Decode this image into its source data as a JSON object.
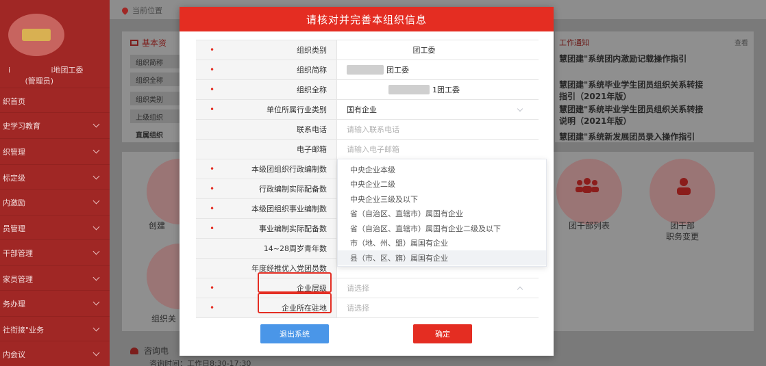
{
  "topbar": {
    "location_label": "当前位置"
  },
  "sidebar": {
    "org_name": "i                 i地团工委\n       (管理员)",
    "items": [
      {
        "label": "织首页",
        "has_chevron": false
      },
      {
        "label": "史学习教育",
        "has_chevron": true
      },
      {
        "label": "织管理",
        "has_chevron": true
      },
      {
        "label": "标定级",
        "has_chevron": true
      },
      {
        "label": "内激励",
        "has_chevron": true
      },
      {
        "label": "员管理",
        "has_chevron": true
      },
      {
        "label": "干部管理",
        "has_chevron": true
      },
      {
        "label": "家员管理",
        "has_chevron": true
      },
      {
        "label": "务办理",
        "has_chevron": true
      },
      {
        "label": "社衔接\"业务",
        "has_chevron": true
      },
      {
        "label": "内会议",
        "has_chevron": true
      }
    ]
  },
  "basic_panel": {
    "title": "基本资",
    "rows": [
      "组织简称",
      "组织全称",
      "组织类别",
      "上级组织",
      "直属组织"
    ]
  },
  "notice_panel": {
    "title": "工作通知",
    "more": "查看",
    "items": [
      "慧团建\"系统团内激励记载操作指引",
      "慧团建\"系统毕业学生团员组织关系转接\n指引（2021年版）",
      "慧团建\"系统毕业学生团员组织关系转接\n说明（2021年版）",
      "慧团建\"系统新发展团员录入操作指引"
    ]
  },
  "func_panel": {
    "items": [
      {
        "label": "创建"
      },
      {
        "label": "组织关"
      },
      {
        "label": "团干部列表"
      },
      {
        "label": "团干部\n职务变更"
      }
    ]
  },
  "consult": {
    "label": "咨询电",
    "time": "咨询时间：工作日8:30-17:30"
  },
  "modal": {
    "title": "请核对并完善本组织信息",
    "fields": [
      {
        "label": "组织类别",
        "required": true,
        "value": "团工委",
        "centered": true
      },
      {
        "label": "组织简称",
        "required": true,
        "value": "团工委",
        "blurred": true
      },
      {
        "label": "组织全称",
        "required": true,
        "value": "1团工委",
        "centered": true,
        "blurred": true
      },
      {
        "label": "单位所属行业类别",
        "required": true,
        "value": "国有企业",
        "select": "down"
      },
      {
        "label": "联系电话",
        "required": false,
        "placeholder": "请输入联系电话"
      },
      {
        "label": "电子邮箱",
        "required": false,
        "placeholder": "请输入电子邮箱"
      },
      {
        "label": "本级团组织行政编制数",
        "required": true
      },
      {
        "label": "行政编制实际配备数",
        "required": true
      },
      {
        "label": "本级团组织事业编制数",
        "required": true
      },
      {
        "label": "事业编制实际配备数",
        "required": true
      },
      {
        "label": "14~28周岁青年数",
        "required": false
      },
      {
        "label": "年度经推优入党团员数",
        "required": false
      },
      {
        "label": "企业层级",
        "required": true,
        "placeholder": "请选择",
        "select": "up"
      },
      {
        "label": "企业所在驻地",
        "required": true,
        "placeholder": "请选择"
      }
    ],
    "dropdown": [
      "中央企业本级",
      "中央企业二级",
      "中央企业三级及以下",
      "省（自治区、直辖市）属国有企业",
      "省（自治区、直辖市）属国有企业二级及以下",
      "市（地、州、盟）属国有企业",
      "县（市、区、旗）属国有企业"
    ],
    "buttons": {
      "exit": "退出系统",
      "confirm": "确定"
    }
  }
}
